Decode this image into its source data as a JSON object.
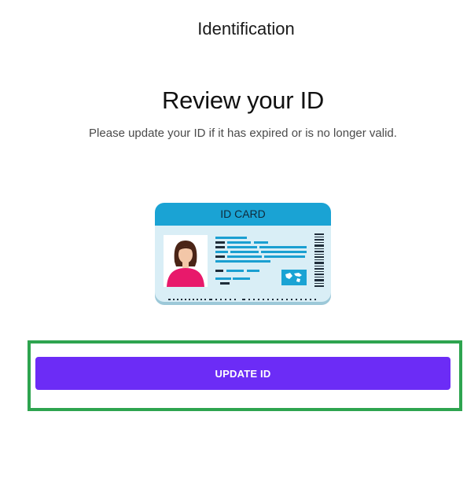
{
  "header": {
    "title": "Identification"
  },
  "main": {
    "title": "Review your ID",
    "subtitle": "Please update your ID if it has expired or is no longer valid.",
    "illustration": {
      "icon": "id-card-illustration",
      "card_label": "ID CARD"
    },
    "update_button_label": "UPDATE ID"
  },
  "colors": {
    "accent": "#6c2cf6",
    "highlight": "#2ea44f",
    "card_header": "#1ba6d6",
    "card_body": "#d7eef7"
  }
}
